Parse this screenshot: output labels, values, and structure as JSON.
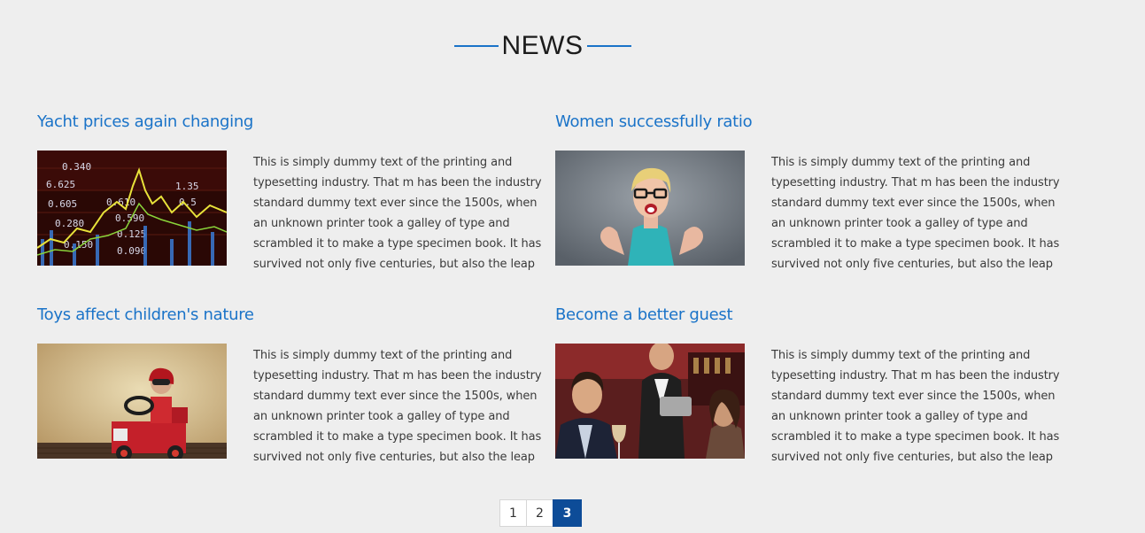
{
  "news": {
    "heading": "NEWS",
    "accent": "#1a73c8",
    "articles": [
      {
        "title": "Yacht prices again changing",
        "image": "stock-market-chart-image",
        "lines": [
          "This is simply dummy text of the printing and",
          "typesetting industry. That m has been the industry",
          "standard dummy text ever since the 1500s, when",
          "an unknown printer took a galley of type and",
          "scrambled it to make a type specimen book. It has",
          "survived not only five centuries, but also the leap"
        ]
      },
      {
        "title": "Women successfully ratio",
        "image": "excited-woman-image",
        "lines": [
          "This is simply dummy text of the printing and",
          "typesetting industry. That m has been the industry",
          "standard dummy text ever since the 1500s, when",
          "an unknown printer took a galley of type and",
          "scrambled it to make a type specimen book. It has",
          "survived not only five centuries, but also the leap"
        ]
      },
      {
        "title": "Toys affect children's nature",
        "image": "child-toy-car-image",
        "lines": [
          "This is simply dummy text of the printing and",
          "typesetting industry. That m has been the industry",
          "standard dummy text ever since the 1500s, when",
          "an unknown printer took a galley of type and",
          "scrambled it to make a type specimen book. It has",
          "survived not only five centuries, but also the leap"
        ]
      },
      {
        "title": "Become a better guest",
        "image": "restaurant-guests-image",
        "lines": [
          "This is simply dummy text of the printing and",
          "typesetting industry. That m has been the industry",
          "standard dummy text ever since the 1500s, when",
          "an unknown printer took a galley of type and",
          "scrambled it to make a type specimen book. It has",
          "survived not only five centuries, but also the leap"
        ]
      }
    ]
  },
  "pagination": {
    "pages": [
      "1",
      "2",
      "3"
    ],
    "current": "3",
    "active_color": "#0d4c98"
  }
}
